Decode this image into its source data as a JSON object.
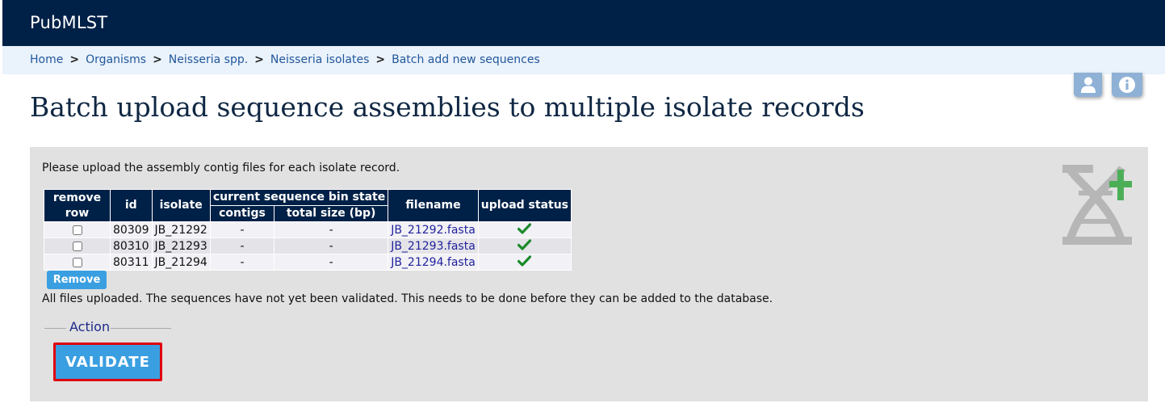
{
  "header": {
    "site_title": "PubMLST"
  },
  "breadcrumb": {
    "items": [
      "Home",
      "Organisms",
      "Neisseria spp.",
      "Neisseria isolates",
      "Batch add new sequences"
    ],
    "separator": ">"
  },
  "toolbar": {
    "user_icon": "user-icon",
    "info_icon": "info-icon"
  },
  "page": {
    "title": "Batch upload sequence assemblies to multiple isolate records"
  },
  "content": {
    "intro": "Please upload the assembly contig files for each isolate record.",
    "table": {
      "headers": {
        "remove_row": "remove row",
        "id": "id",
        "isolate": "isolate",
        "seqbin_state": "current sequence bin state",
        "contigs": "contigs",
        "total_size": "total size (bp)",
        "filename": "filename",
        "upload_status": "upload status"
      },
      "rows": [
        {
          "id": "80309",
          "isolate": "JB_21292",
          "contigs": "-",
          "total_size": "-",
          "filename": "JB_21292.fasta",
          "status": "check-icon"
        },
        {
          "id": "80310",
          "isolate": "JB_21293",
          "contigs": "-",
          "total_size": "-",
          "filename": "JB_21293.fasta",
          "status": "check-icon"
        },
        {
          "id": "80311",
          "isolate": "JB_21294",
          "contigs": "-",
          "total_size": "-",
          "filename": "JB_21294.fasta",
          "status": "check-icon"
        }
      ]
    },
    "remove_label": "Remove",
    "status_message": "All files uploaded. The sequences have not yet been validated. This needs to be done before they can be added to the database.",
    "action_legend": "Action",
    "validate_label": "VALIDATE"
  },
  "colors": {
    "header_bg": "#002147",
    "breadcrumb_bg": "#eaf2fb",
    "link": "#22589c",
    "button": "#3a9fe0",
    "highlight_border": "#e0000f",
    "check": "#1b8a2b",
    "panel_bg": "#e1e1e1"
  },
  "decor": {
    "dna_icon": "dna-add-icon"
  }
}
